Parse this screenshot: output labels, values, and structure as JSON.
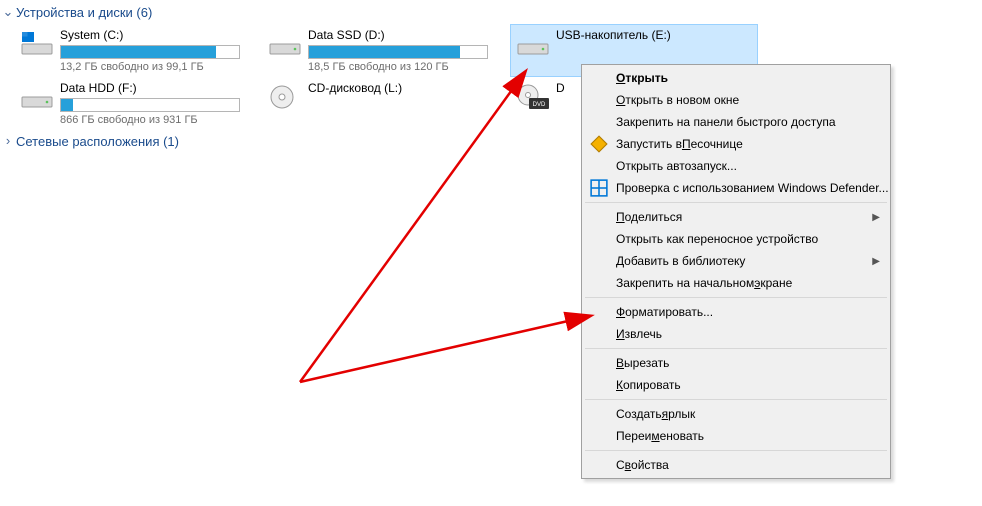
{
  "sections": {
    "devices": {
      "label": "Устройства и диски (6)",
      "expanded": true
    },
    "network": {
      "label": "Сетевые расположения (1)",
      "expanded": false
    }
  },
  "drives": [
    {
      "name": "System (C:)",
      "sub": "13,2 ГБ свободно из 99,1 ГБ",
      "fill": 87,
      "icon": "os-drive",
      "bar": true
    },
    {
      "name": "Data SSD (D:)",
      "sub": "18,5 ГБ свободно из 120 ГБ",
      "fill": 85,
      "icon": "hdd",
      "bar": true
    },
    {
      "name": "USB-накопитель (E:)",
      "sub": "",
      "fill": 0,
      "icon": "usb",
      "bar": false,
      "selected": true
    },
    {
      "name": "Data HDD (F:)",
      "sub": "866 ГБ свободно из 931 ГБ",
      "fill": 7,
      "icon": "hdd",
      "bar": true
    },
    {
      "name": "CD-дисковод (L:)",
      "sub": "",
      "fill": 0,
      "icon": "cd",
      "bar": false
    },
    {
      "name": "D",
      "sub": "",
      "fill": 0,
      "icon": "dvd",
      "bar": false
    }
  ],
  "menu": {
    "open": "ткрыть",
    "open_new": "ткрыть в новом окне",
    "pin_quick": "Закрепить на панели быстрого доступа",
    "sandbox": "Запустить в ",
    "sandbox2": "есочнице",
    "autorun": "Открыть автозапуск...",
    "defender": "Проверка с использованием Windows Defender...",
    "share": "оделиться",
    "portable": "Открыть как переносное устройство",
    "library": "обавить в библиотеку",
    "pin_start": "Закрепить на начальном ",
    "pin_start2": "кране",
    "format": "орматировать...",
    "eject": "звлечь",
    "cut": "ырезать",
    "copy": "опировать",
    "shortcut": "Создать ",
    "shortcut2": "рлык",
    "rename": "Переи",
    "rename2": "еновать",
    "props": "С",
    "props2": "ойства"
  },
  "letters": {
    "O": "О",
    "P": "П",
    "D": "Д",
    "F": "Ф",
    "I": "И",
    "V": "В",
    "K": "К",
    "Y": "я",
    "M": "м",
    "E": "э",
    "v2": "в"
  }
}
